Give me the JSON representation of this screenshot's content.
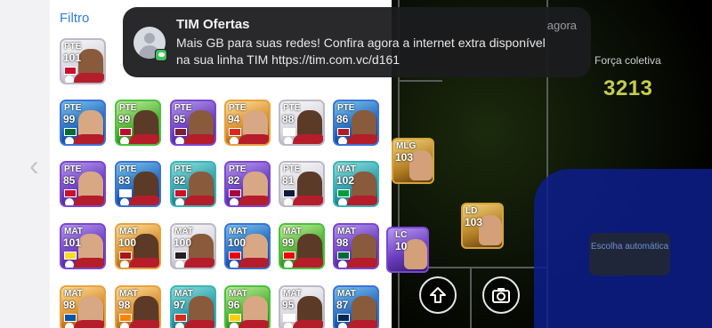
{
  "app": {
    "filter_label": "Filtro",
    "back_icon": "chevron-left-icon"
  },
  "player_grid": [
    {
      "pos": "PTE",
      "rating": "101",
      "style": "c-gray",
      "flag": "#c8102e"
    },
    {
      "pos": "PTE",
      "rating": "99",
      "style": "c-blue",
      "flag": "#046a38"
    },
    {
      "pos": "PTE",
      "rating": "99",
      "style": "c-green",
      "flag": "#ba0c2f"
    },
    {
      "pos": "PTE",
      "rating": "95",
      "style": "c-purple",
      "flag": "#7d1b3a"
    },
    {
      "pos": "PTE",
      "rating": "94",
      "style": "c-orange",
      "flag": "#da291c"
    },
    {
      "pos": "PTE",
      "rating": "88",
      "style": "c-gray",
      "flag": "#ffffff"
    },
    {
      "pos": "PTE",
      "rating": "86",
      "style": "c-blue",
      "flag": "#ae1c28"
    },
    {
      "pos": "PTE",
      "rating": "85",
      "style": "c-purple",
      "flag": "#c8102e"
    },
    {
      "pos": "PTE",
      "rating": "83",
      "style": "c-blue",
      "flag": "#ffffff"
    },
    {
      "pos": "PTE",
      "rating": "82",
      "style": "c-teal",
      "flag": "#ce1126"
    },
    {
      "pos": "PTE",
      "rating": "82",
      "style": "c-purple",
      "flag": "#a50044"
    },
    {
      "pos": "PTE",
      "rating": "81",
      "style": "c-gray",
      "flag": "#0e1a3b"
    },
    {
      "pos": "MAT",
      "rating": "102",
      "style": "c-teal",
      "flag": "#009c3b"
    },
    {
      "pos": "MAT",
      "rating": "101",
      "style": "c-purple",
      "flag": "#fdda24"
    },
    {
      "pos": "MAT",
      "rating": "100",
      "style": "c-orange",
      "flag": "#aa151b"
    },
    {
      "pos": "MAT",
      "rating": "100",
      "style": "c-gray",
      "flag": "#241f20"
    },
    {
      "pos": "MAT",
      "rating": "100",
      "style": "c-blue",
      "flag": "#ef0107"
    },
    {
      "pos": "MAT",
      "rating": "99",
      "style": "c-green",
      "flag": "#ef0107"
    },
    {
      "pos": "MAT",
      "rating": "98",
      "style": "c-purple",
      "flag": "#046a38"
    },
    {
      "pos": "MAT",
      "rating": "98",
      "style": "c-orange",
      "flag": "#0055a4"
    },
    {
      "pos": "MAT",
      "rating": "98",
      "style": "c-orange",
      "flag": "#ff8200"
    },
    {
      "pos": "MAT",
      "rating": "97",
      "style": "c-teal",
      "flag": "#da291c"
    },
    {
      "pos": "MAT",
      "rating": "96",
      "style": "c-green",
      "flag": "#ffcd00"
    },
    {
      "pos": "MAT",
      "rating": "95",
      "style": "c-gray",
      "flag": "#ffffff"
    },
    {
      "pos": "MAT",
      "rating": "87",
      "style": "c-blue",
      "flag": "#002654"
    }
  ],
  "pitch": {
    "force_label": "Força coletiva",
    "force_value": "3213",
    "auto_button": "Escolha automática",
    "cards": [
      {
        "pos": "MLG",
        "rating": "103"
      },
      {
        "pos": "LD",
        "rating": "103"
      },
      {
        "pos": "LC",
        "rating": "10"
      }
    ],
    "action_icon": "arrow-up-circle-icon",
    "camera_icon": "camera-icon"
  },
  "notification": {
    "title": "TIM Ofertas",
    "time": "agora",
    "body": "Mais GB para suas redes! Confira agora a internet extra disponível na sua linha TIM https://tim.com.vc/d161",
    "icon": "contact-avatar-icon",
    "badge_icon": "messages-icon"
  },
  "colors": {
    "filter_blue": "#2f7de1",
    "force_value": "#c6cd4a",
    "auto_button_text": "#6e8fd0",
    "notification_bg": "#1c1c1e"
  }
}
